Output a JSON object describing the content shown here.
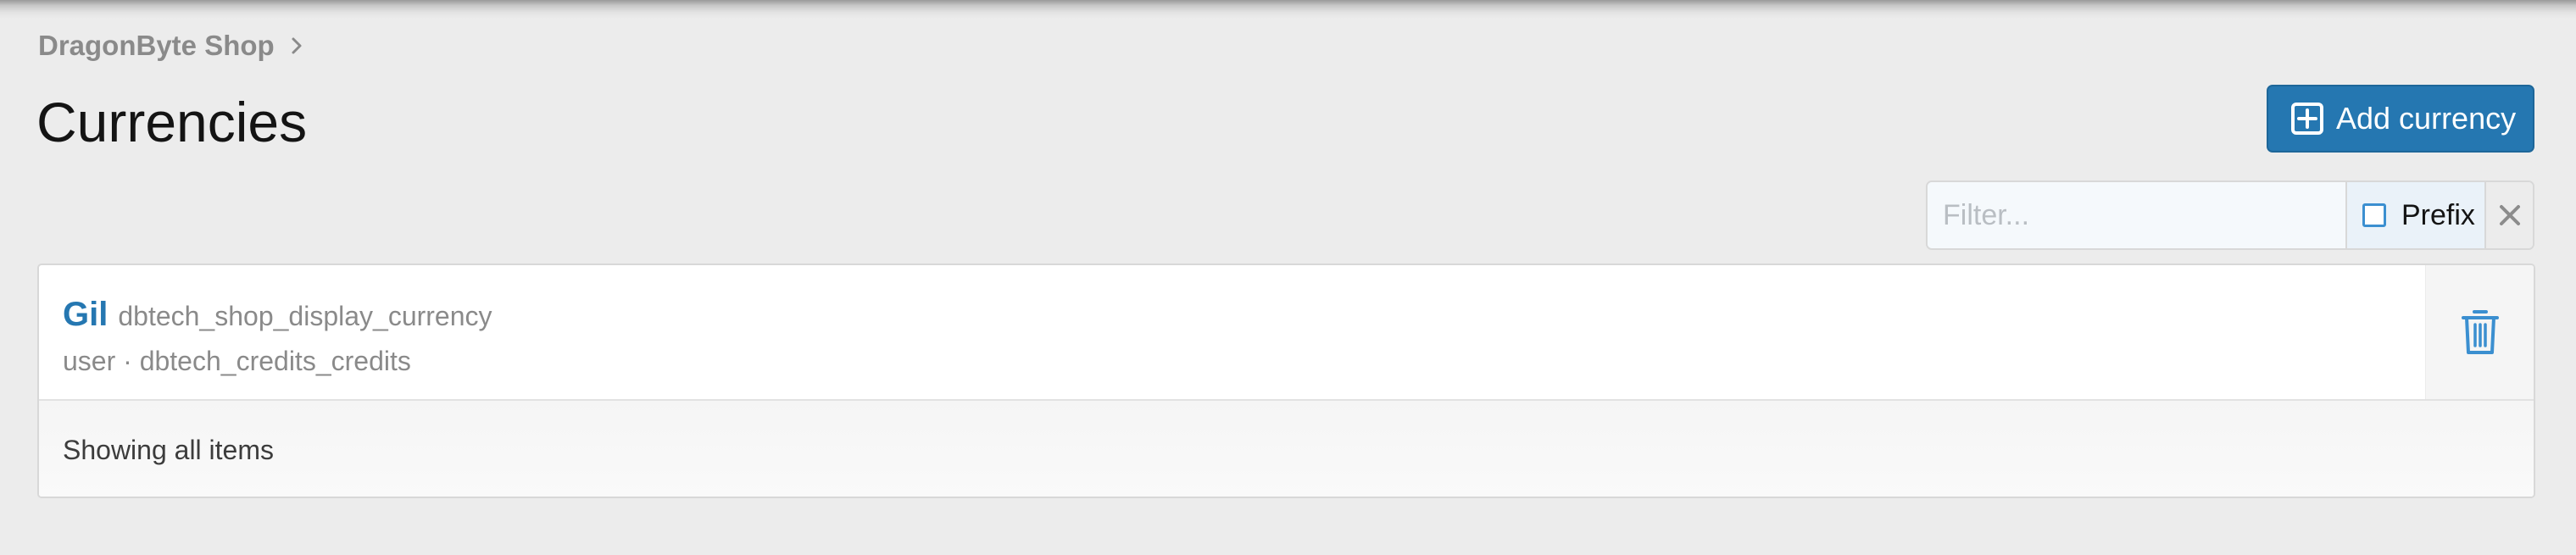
{
  "breadcrumb": {
    "items": [
      {
        "label": "DragonByte Shop"
      }
    ]
  },
  "page": {
    "title": "Currencies"
  },
  "actions": {
    "add_label": "Add currency"
  },
  "filter": {
    "placeholder": "Filter...",
    "value": "",
    "prefix_label": "Prefix",
    "prefix_checked": false
  },
  "list": {
    "rows": [
      {
        "title": "Gil",
        "subtitle": "dbtech_shop_display_currency",
        "hint": "user · dbtech_credits_credits"
      }
    ],
    "footer_text": "Showing all items"
  },
  "colors": {
    "accent": "#2577b1",
    "background": "#ececec"
  },
  "icons": {
    "breadcrumb_separator": "chevron-right-icon",
    "add": "plus-square-icon",
    "clear": "close-icon",
    "delete": "trash-icon"
  }
}
